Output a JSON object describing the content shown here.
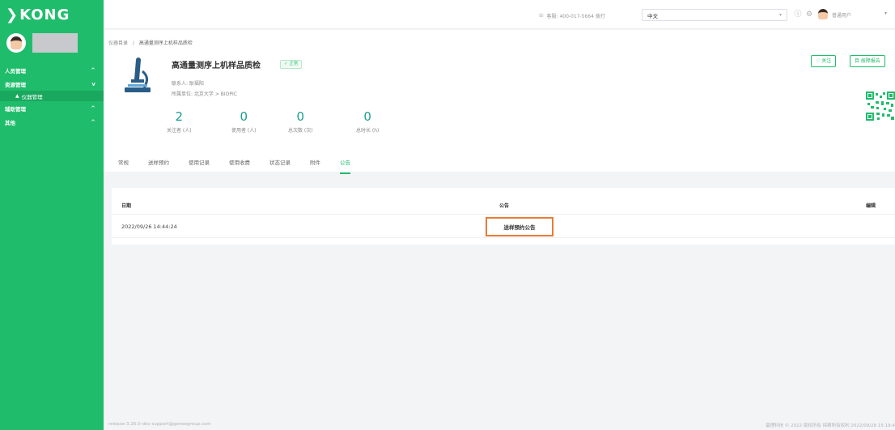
{
  "sidebar": {
    "logo": "KONG",
    "items": [
      {
        "label": "人员管理",
        "chevron": "^"
      },
      {
        "label": "资源管理",
        "chevron": "v"
      },
      {
        "label": "仪器管理",
        "sub": true
      },
      {
        "label": "辅助管理",
        "chevron": "^"
      },
      {
        "label": "其他",
        "chevron": "^"
      }
    ]
  },
  "header": {
    "hotline": "客服: 400-017-5664 拨打",
    "language": "中文",
    "user": "普通用户"
  },
  "breadcrumb": {
    "root": "仪器目录",
    "separator": "/",
    "current": "高通量测序上机样品质检"
  },
  "instrument": {
    "title": "高通量测序上机样品质检",
    "status": "正常",
    "contact": "联系人: 耿福阳",
    "org": "所属单位: 北京大学 > BIOPIC"
  },
  "stats": [
    {
      "value": "2",
      "label": "关注者 (人)"
    },
    {
      "value": "0",
      "label": "使用者 (人)"
    },
    {
      "value": "0",
      "label": "总次数 (次)"
    },
    {
      "value": "0",
      "label": "总时长 (h)"
    }
  ],
  "tabs": [
    "常规",
    "送样预约",
    "使用记录",
    "使用收费",
    "状态记录",
    "附件",
    "公告"
  ],
  "actions": {
    "follow": "♡ 关注",
    "report": "目 故障报告"
  },
  "table": {
    "headers": {
      "date": "日期",
      "notice": "公告",
      "edit": "编辑"
    },
    "rows": [
      {
        "date": "2022/09/26 14:44:24",
        "notice": "送样预约公告"
      }
    ]
  },
  "footer": {
    "left": "release-3.26.0-dev   support@geneegroup.com",
    "right": "基理科技 © 2022 版权所有  探察所有权利  2022/09/28 15:19:4"
  },
  "colors": {
    "brand": "#1fbd6b",
    "highlight": "#ec7b35",
    "stat": "#1a9e8f"
  }
}
